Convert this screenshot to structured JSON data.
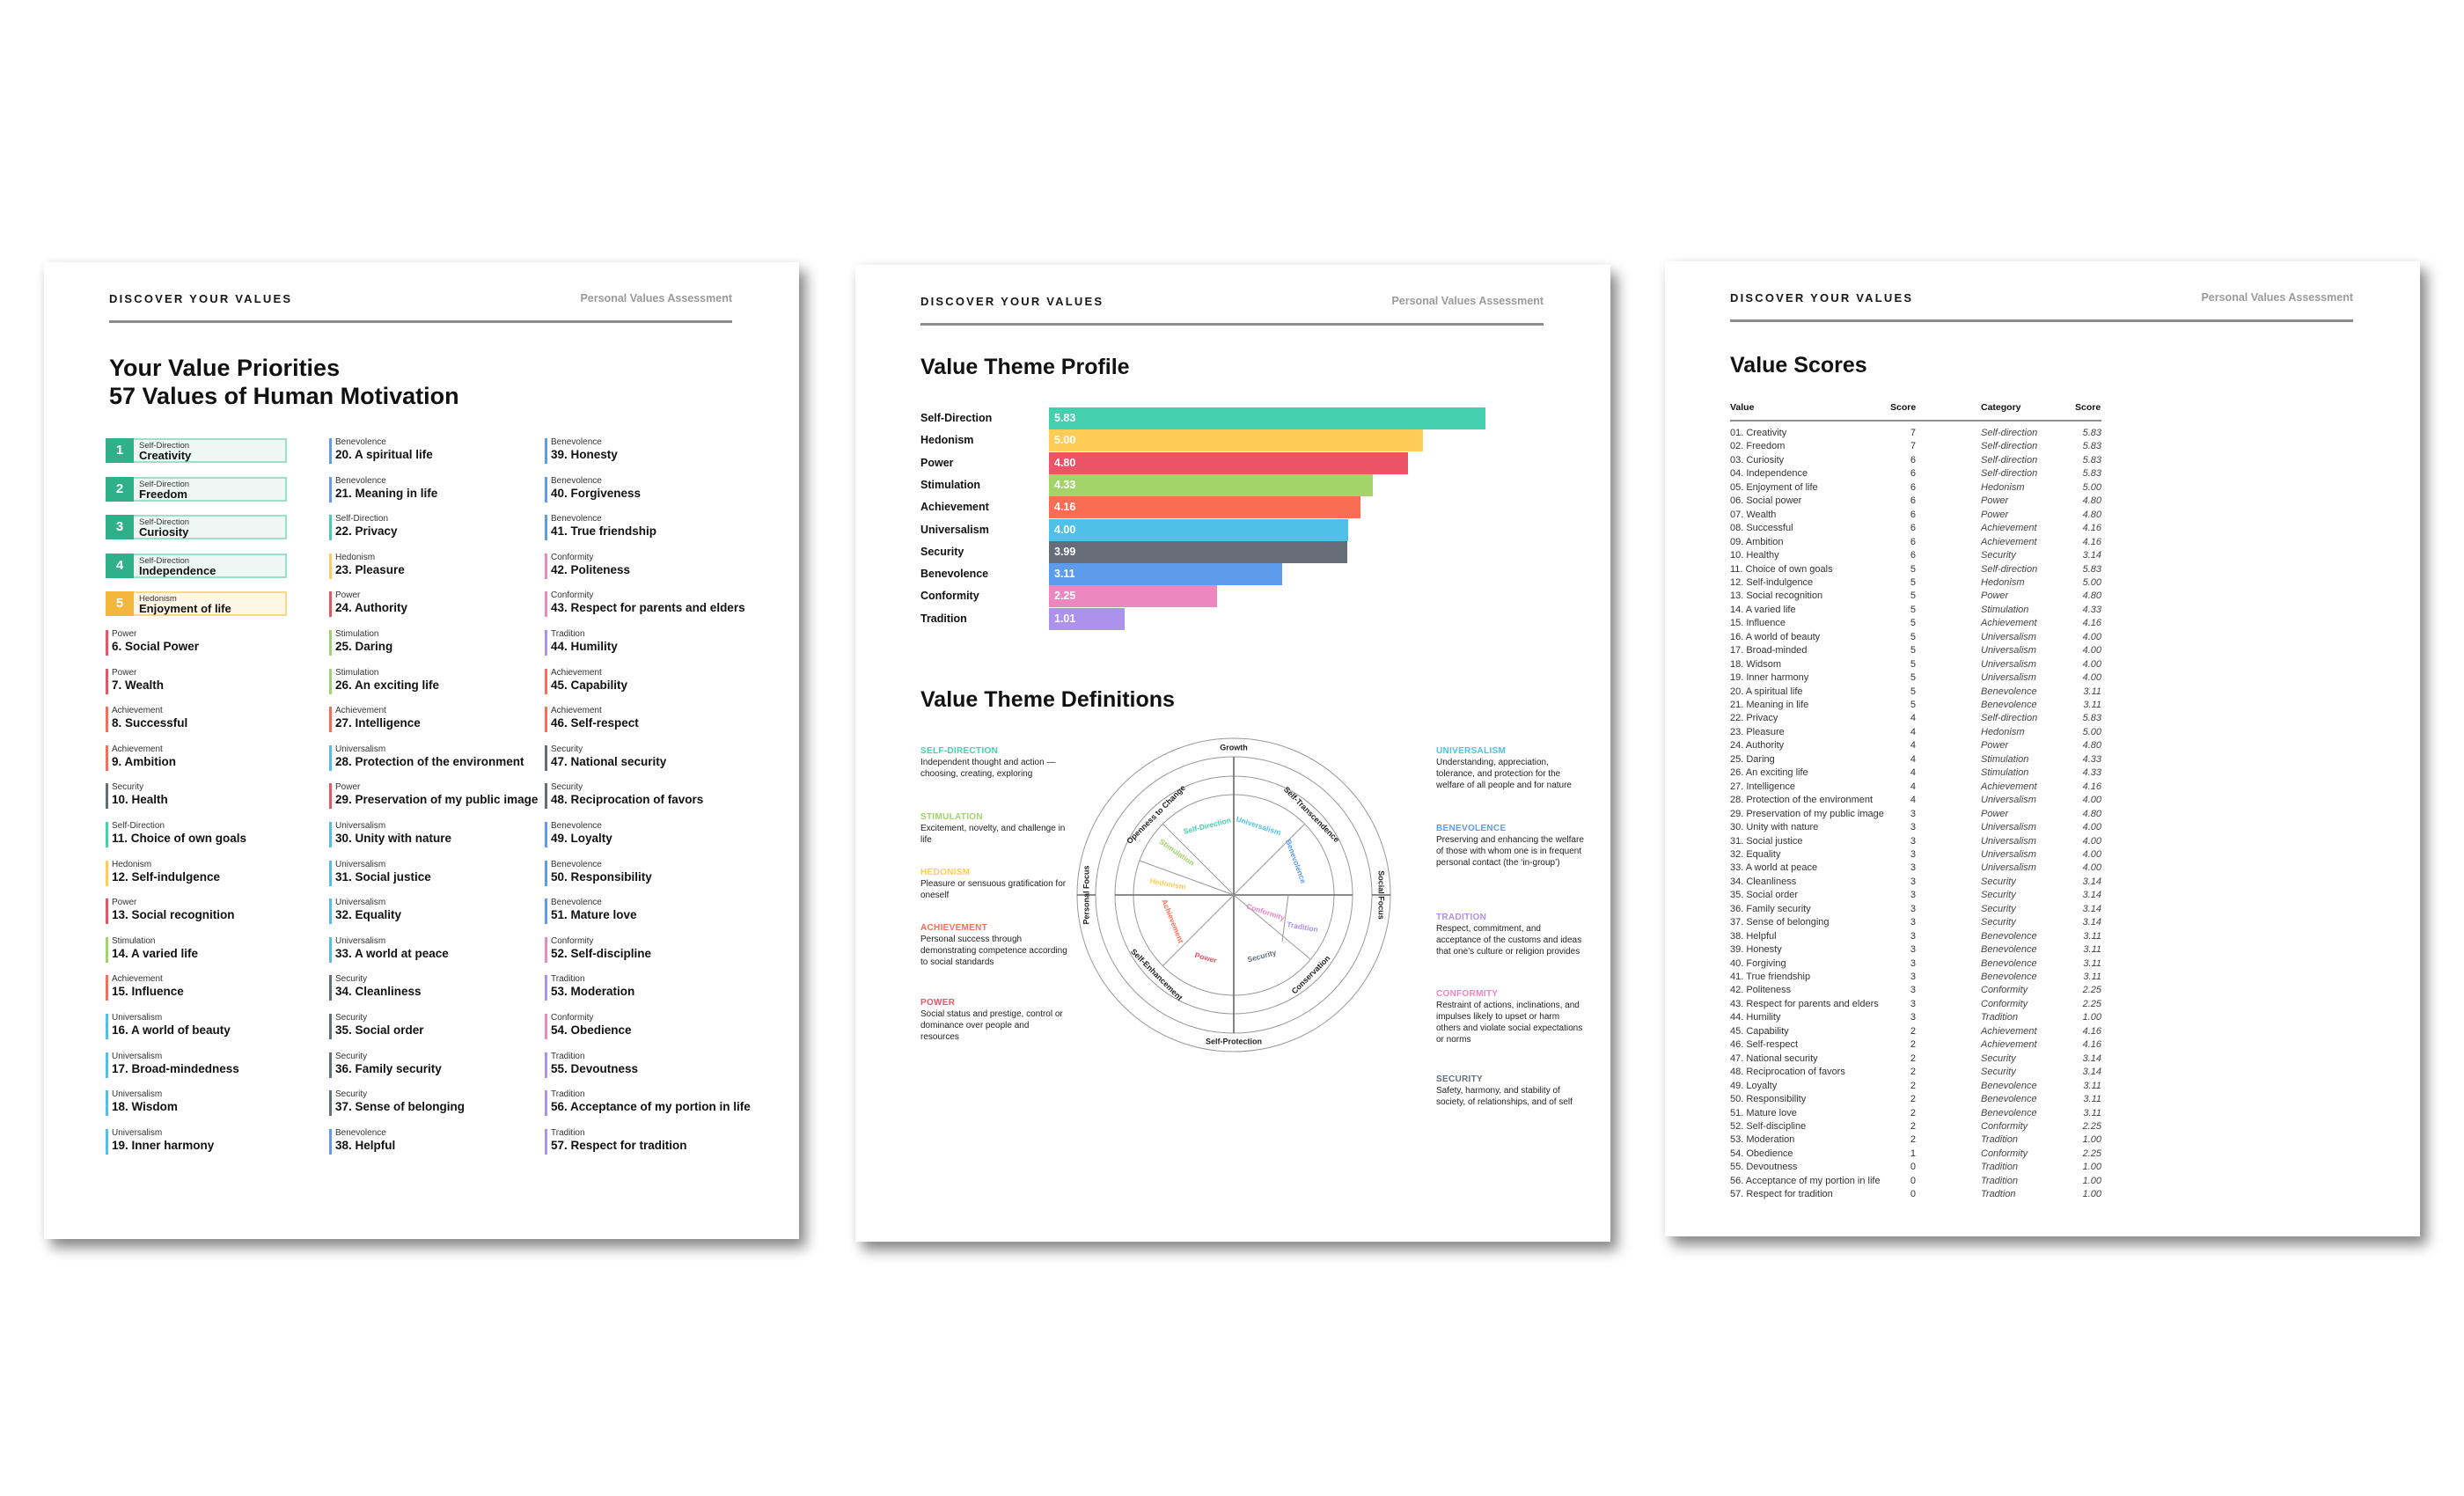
{
  "header": {
    "brand": "DISCOVER YOUR VALUES",
    "subtitle": "Personal Values Assessment"
  },
  "colors": {
    "Self-Direction": "#44cfae",
    "Hedonism": "#ffcc55",
    "Power": "#ea5466",
    "Stimulation": "#a2d469",
    "Achievement": "#f96e52",
    "Universalism": "#4fc0e8",
    "Security": "#656d78",
    "Benevolence": "#5d9cec",
    "Conformity": "#ec87c0",
    "Tradition": "#ac92ec"
  },
  "page1": {
    "title_line1": "Your Value Priorities",
    "title_line2": "57 Values of Human Motivation",
    "top5": [
      {
        "rank": "1",
        "category": "Self-Direction",
        "name": "Creativity"
      },
      {
        "rank": "2",
        "category": "Self-Direction",
        "name": "Freedom"
      },
      {
        "rank": "3",
        "category": "Self-Direction",
        "name": "Curiosity"
      },
      {
        "rank": "4",
        "category": "Self-Direction",
        "name": "Independence"
      },
      {
        "rank": "5",
        "category": "Hedonism",
        "name": "Enjoyment of life"
      }
    ],
    "items": [
      {
        "category": "Power",
        "name": "6. Social Power"
      },
      {
        "category": "Power",
        "name": "7. Wealth"
      },
      {
        "category": "Achievement",
        "name": "8. Successful"
      },
      {
        "category": "Achievement",
        "name": "9. Ambition"
      },
      {
        "category": "Security",
        "name": "10. Health"
      },
      {
        "category": "Self-Direction",
        "name": "11. Choice of own goals"
      },
      {
        "category": "Hedonism",
        "name": "12. Self-indulgence"
      },
      {
        "category": "Power",
        "name": "13. Social recognition"
      },
      {
        "category": "Stimulation",
        "name": "14. A varied life"
      },
      {
        "category": "Achievement",
        "name": "15. Influence"
      },
      {
        "category": "Universalism",
        "name": "16. A world of beauty"
      },
      {
        "category": "Universalism",
        "name": "17. Broad-mindedness"
      },
      {
        "category": "Universalism",
        "name": "18. Wisdom"
      },
      {
        "category": "Universalism",
        "name": "19. Inner harmony"
      },
      {
        "category": "Benevolence",
        "name": "20. A spiritual life"
      },
      {
        "category": "Benevolence",
        "name": "21. Meaning in life"
      },
      {
        "category": "Self-Direction",
        "name": "22. Privacy"
      },
      {
        "category": "Hedonism",
        "name": "23. Pleasure"
      },
      {
        "category": "Power",
        "name": "24. Authority"
      },
      {
        "category": "Stimulation",
        "name": "25. Daring"
      },
      {
        "category": "Stimulation",
        "name": "26. An exciting life"
      },
      {
        "category": "Achievement",
        "name": "27. Intelligence"
      },
      {
        "category": "Universalism",
        "name": "28. Protection of the environment"
      },
      {
        "category": "Power",
        "name": "29. Preservation of my public image"
      },
      {
        "category": "Universalism",
        "name": "30. Unity with nature"
      },
      {
        "category": "Universalism",
        "name": "31. Social justice"
      },
      {
        "category": "Universalism",
        "name": "32. Equality"
      },
      {
        "category": "Universalism",
        "name": "33. A world at peace"
      },
      {
        "category": "Security",
        "name": "34. Cleanliness"
      },
      {
        "category": "Security",
        "name": "35. Social order"
      },
      {
        "category": "Security",
        "name": "36. Family security"
      },
      {
        "category": "Security",
        "name": "37. Sense of belonging"
      },
      {
        "category": "Benevolence",
        "name": "38. Helpful"
      },
      {
        "category": "Benevolence",
        "name": "39. Honesty"
      },
      {
        "category": "Benevolence",
        "name": "40. Forgiveness"
      },
      {
        "category": "Benevolence",
        "name": "41. True friendship"
      },
      {
        "category": "Conformity",
        "name": "42. Politeness"
      },
      {
        "category": "Conformity",
        "name": "43. Respect for parents and elders"
      },
      {
        "category": "Tradition",
        "name": "44. Humility"
      },
      {
        "category": "Achievement",
        "name": "45. Capability"
      },
      {
        "category": "Achievement",
        "name": "46. Self-respect"
      },
      {
        "category": "Security",
        "name": "47. National security"
      },
      {
        "category": "Security",
        "name": "48. Reciprocation of favors"
      },
      {
        "category": "Benevolence",
        "name": "49. Loyalty"
      },
      {
        "category": "Benevolence",
        "name": "50. Responsibility"
      },
      {
        "category": "Benevolence",
        "name": "51. Mature love"
      },
      {
        "category": "Conformity",
        "name": "52. Self-discipline"
      },
      {
        "category": "Tradition",
        "name": "53. Moderation"
      },
      {
        "category": "Conformity",
        "name": "54. Obedience"
      },
      {
        "category": "Tradition",
        "name": "55. Devoutness"
      },
      {
        "category": "Tradition",
        "name": "56. Acceptance of my portion in life"
      },
      {
        "category": "Tradition",
        "name": "57. Respect for tradition"
      }
    ]
  },
  "page2": {
    "profile_title": "Value Theme Profile",
    "definitions_title": "Value Theme Definitions",
    "definitions_left": [
      {
        "key": "Self-Direction",
        "head": "SELF-DIRECTION",
        "text": "Independent thought and action — choosing, creating, exploring"
      },
      {
        "key": "Stimulation",
        "head": "STIMULATION",
        "text": "Excitement, novelty, and challenge in life"
      },
      {
        "key": "Hedonism",
        "head": "HEDONISM",
        "text": "Pleasure or sensuous gratification for oneself"
      },
      {
        "key": "Achievement",
        "head": "ACHIEVEMENT",
        "text": "Personal success through demonstrating competence according to social standards"
      },
      {
        "key": "Power",
        "head": "POWER",
        "text": "Social status and prestige, control or dominance over people and resources"
      }
    ],
    "definitions_right": [
      {
        "key": "Universalism",
        "head": "UNIVERSALISM",
        "text": "Understanding, appreciation, tolerance, and protection for the welfare of all people and for nature"
      },
      {
        "key": "Benevolence",
        "head": "BENEVOLENCE",
        "text": "Preserving and enhancing the welfare of those with whom one is in frequent personal contact (the ‘in-group’)"
      },
      {
        "key": "Tradition",
        "head": "TRADITION",
        "text": "Respect, commitment, and acceptance of the customs and ideas that one’s culture or religion provides"
      },
      {
        "key": "Conformity",
        "head": "CONFORMITY",
        "text": "Restraint of actions, inclinations, and impulses likely to upset or harm others and violate social expectations or norms"
      },
      {
        "key": "Security",
        "head": "SECURITY",
        "text": "Safety, harmony, and stability of society, of relationships, and of self"
      }
    ],
    "wheel": {
      "outer_top": "Growth",
      "outer_bottom": "Self-Protection",
      "outer_left": "Personal Focus",
      "outer_right": "Social Focus",
      "higher_order": [
        "Openness to Change",
        "Self-Transcendence",
        "Conservation",
        "Self-Enhancement"
      ],
      "themes": [
        "Self-Direction",
        "Universalism",
        "Benevolence",
        "Tradition",
        "Conformity",
        "Security",
        "Power",
        "Achievement",
        "Hedonism",
        "Stimulation"
      ]
    }
  },
  "chart_data": {
    "type": "bar",
    "orientation": "horizontal",
    "title": "Value Theme Profile",
    "xlabel": "",
    "ylabel": "",
    "categories": [
      "Self-Direction",
      "Hedonism",
      "Power",
      "Stimulation",
      "Achievement",
      "Universalism",
      "Security",
      "Benevolence",
      "Conformity",
      "Tradition"
    ],
    "values": [
      5.83,
      5.0,
      4.8,
      4.33,
      4.16,
      4.0,
      3.99,
      3.11,
      2.25,
      1.01
    ],
    "value_labels": [
      "5.83",
      "5.00",
      "4.80",
      "4.33",
      "4.16",
      "4.00",
      "3.99",
      "3.11",
      "2.25",
      "1.01"
    ],
    "xlim": [
      0,
      7
    ],
    "grid": false,
    "legend": "none"
  },
  "page3": {
    "title": "Value Scores",
    "headers": [
      "Value",
      "Score",
      "Category",
      "Score"
    ],
    "rows": [
      [
        "01. Creativity",
        "7",
        "Self-direction",
        "5.83"
      ],
      [
        "02. Freedom",
        "7",
        "Self-direction",
        "5.83"
      ],
      [
        "03. Curiosity",
        "6",
        "Self-direction",
        "5.83"
      ],
      [
        "04. Independence",
        "6",
        "Self-direction",
        "5.83"
      ],
      [
        "05. Enjoyment of life",
        "6",
        "Hedonism",
        "5.00"
      ],
      [
        "06. Social power",
        "6",
        "Power",
        "4.80"
      ],
      [
        "07. Wealth",
        "6",
        "Power",
        "4.80"
      ],
      [
        "08. Successful",
        "6",
        "Achievement",
        "4.16"
      ],
      [
        "09. Ambition",
        "6",
        "Achievement",
        "4.16"
      ],
      [
        "10. Healthy",
        "6",
        "Security",
        "3.14"
      ],
      [
        "11. Choice of own goals",
        "5",
        "Self-direction",
        "5.83"
      ],
      [
        "12. Self-indulgence",
        "5",
        "Hedonism",
        "5.00"
      ],
      [
        "13. Social recognition",
        "5",
        "Power",
        "4.80"
      ],
      [
        "14. A varied life",
        "5",
        "Stimulation",
        "4.33"
      ],
      [
        "15. Influence",
        "5",
        "Achievement",
        "4.16"
      ],
      [
        "16. A world of beauty",
        "5",
        "Universalism",
        "4.00"
      ],
      [
        "17. Broad-minded",
        "5",
        "Universalism",
        "4.00"
      ],
      [
        "18. Widsom",
        "5",
        "Universalism",
        "4.00"
      ],
      [
        "19. Inner harmony",
        "5",
        "Universalism",
        "4.00"
      ],
      [
        "20. A spiritual life",
        "5",
        "Benevolence",
        "3.11"
      ],
      [
        "21. Meaning in life",
        "5",
        "Benevolence",
        "3.11"
      ],
      [
        "22. Privacy",
        "4",
        "Self-direction",
        "5.83"
      ],
      [
        "23. Pleasure",
        "4",
        "Hedonism",
        "5.00"
      ],
      [
        "24. Authority",
        "4",
        "Power",
        "4.80"
      ],
      [
        "25. Daring",
        "4",
        "Stimulation",
        "4.33"
      ],
      [
        "26. An exciting life",
        "4",
        "Stimulation",
        "4.33"
      ],
      [
        "27. Intelligence",
        "4",
        "Achievement",
        "4.16"
      ],
      [
        "28. Protection of the environment",
        "4",
        "Universalism",
        "4.00"
      ],
      [
        "29. Preservation of my public image",
        "3",
        "Power",
        "4.80"
      ],
      [
        "30. Unity with nature",
        "3",
        "Universalism",
        "4.00"
      ],
      [
        "31. Social justice",
        "3",
        "Universalism",
        "4.00"
      ],
      [
        "32. Equality",
        "3",
        "Universalism",
        "4.00"
      ],
      [
        "33. A world at peace",
        "3",
        "Universalism",
        "4.00"
      ],
      [
        "34. Cleanliness",
        "3",
        "Security",
        "3.14"
      ],
      [
        "35. Social order",
        "3",
        "Security",
        "3.14"
      ],
      [
        "36. Family security",
        "3",
        "Security",
        "3.14"
      ],
      [
        "37. Sense of belonging",
        "3",
        "Security",
        "3.14"
      ],
      [
        "38. Helpful",
        "3",
        "Benevolence",
        "3.11"
      ],
      [
        "39. Honesty",
        "3",
        "Benevolence",
        "3.11"
      ],
      [
        "40. Forgiving",
        "3",
        "Benevolence",
        "3.11"
      ],
      [
        "41. True friendship",
        "3",
        "Benevolence",
        "3.11"
      ],
      [
        "42. Politeness",
        "3",
        "Conformity",
        "2.25"
      ],
      [
        "43. Respect for parents and elders",
        "3",
        "Conformity",
        "2.25"
      ],
      [
        "44. Humility",
        "3",
        "Tradition",
        "1.00"
      ],
      [
        "45. Capability",
        "2",
        "Achievement",
        "4.16"
      ],
      [
        "46. Self-respect",
        "2",
        "Achievement",
        "4.16"
      ],
      [
        "47. National security",
        "2",
        "Security",
        "3.14"
      ],
      [
        "48. Reciprocation of favors",
        "2",
        "Security",
        "3.14"
      ],
      [
        "49. Loyalty",
        "2",
        "Benevolence",
        "3.11"
      ],
      [
        "50. Responsibility",
        "2",
        "Benevolence",
        "3.11"
      ],
      [
        "51. Mature love",
        "2",
        "Benevolence",
        "3.11"
      ],
      [
        "52. Self-discipline",
        "2",
        "Conformity",
        "2.25"
      ],
      [
        "53. Moderation",
        "2",
        "Tradition",
        "1.00"
      ],
      [
        "54. Obedience",
        "1",
        "Conformity",
        "2.25"
      ],
      [
        "55. Devoutness",
        "0",
        "Tradition",
        "1.00"
      ],
      [
        "56. Acceptance of my portion in life",
        "0",
        "Tradition",
        "1.00"
      ],
      [
        "57. Respect for tradition",
        "0",
        "Tradtion",
        "1.00"
      ]
    ]
  }
}
